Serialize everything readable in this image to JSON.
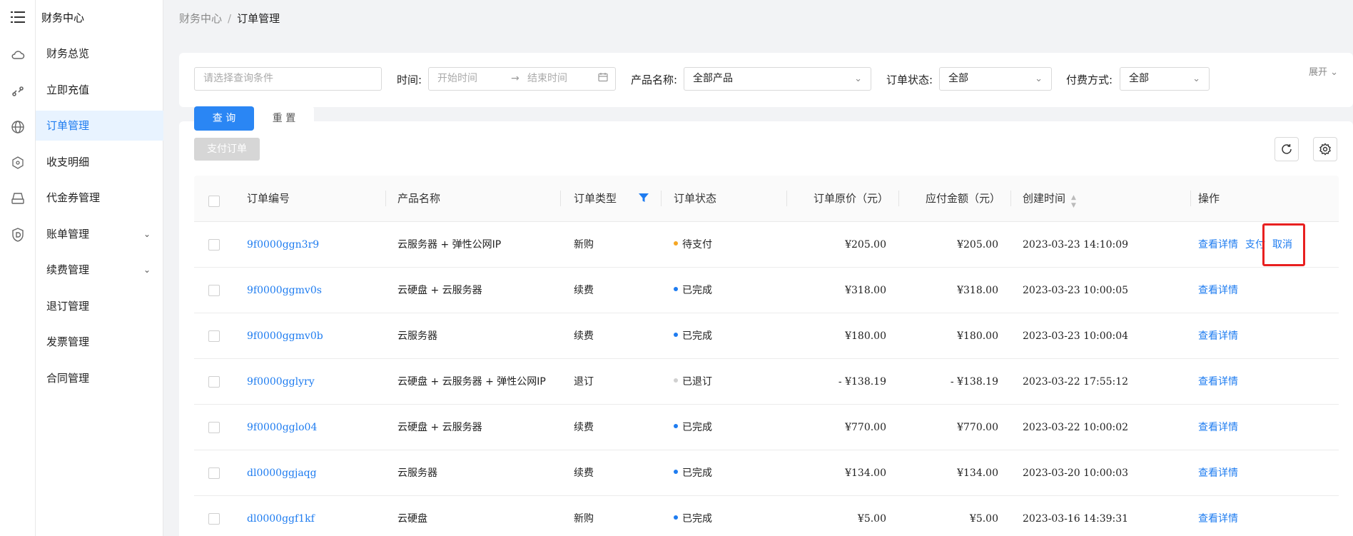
{
  "sidebar": {
    "title": "财务中心",
    "items": [
      {
        "label": "财务总览"
      },
      {
        "label": "立即充值"
      },
      {
        "label": "订单管理",
        "active": true
      },
      {
        "label": "收支明细"
      },
      {
        "label": "代金券管理"
      },
      {
        "label": "账单管理",
        "expandable": true
      },
      {
        "label": "续费管理",
        "expandable": true
      },
      {
        "label": "退订管理"
      },
      {
        "label": "发票管理"
      },
      {
        "label": "合同管理"
      }
    ]
  },
  "breadcrumb": {
    "root": "财务中心",
    "current": "订单管理"
  },
  "filters": {
    "query_placeholder": "请选择查询条件",
    "time_label": "时间:",
    "start_placeholder": "开始时间",
    "end_placeholder": "结束时间",
    "product_label": "产品名称:",
    "product_value": "全部产品",
    "status_label": "订单状态:",
    "status_value": "全部",
    "pay_label": "付费方式:",
    "pay_value": "全部",
    "expand": "展开"
  },
  "buttons": {
    "query": "查 询",
    "reset": "重 置",
    "pay_orders": "支付订单"
  },
  "table": {
    "columns": [
      "订单编号",
      "产品名称",
      "订单类型",
      "订单状态",
      "订单原价（元）",
      "应付金额（元）",
      "创建时间",
      "操作"
    ],
    "rows": [
      {
        "id": "9f0000ggn3r9",
        "product": "云服务器 + 弹性公网IP",
        "type": "新购",
        "status": "待支付",
        "status_color": "#f5a623",
        "orig": "¥205.00",
        "due": "¥205.00",
        "time": "2023-03-23 14:10:09",
        "actions": [
          "查看详情",
          "支付",
          "取消"
        ]
      },
      {
        "id": "9f0000ggmv0s",
        "product": "云硬盘 + 云服务器",
        "type": "续费",
        "status": "已完成",
        "status_color": "#1e7cf0",
        "orig": "¥318.00",
        "due": "¥318.00",
        "time": "2023-03-23 10:00:05",
        "actions": [
          "查看详情"
        ]
      },
      {
        "id": "9f0000ggmv0b",
        "product": "云服务器",
        "type": "续费",
        "status": "已完成",
        "status_color": "#1e7cf0",
        "orig": "¥180.00",
        "due": "¥180.00",
        "time": "2023-03-23 10:00:04",
        "actions": [
          "查看详情"
        ]
      },
      {
        "id": "9f0000gglyry",
        "product": "云硬盘 + 云服务器 + 弹性公网IP",
        "type": "退订",
        "status": "已退订",
        "status_color": "#d0d0d0",
        "orig": "- ¥138.19",
        "due": "- ¥138.19",
        "time": "2023-03-22 17:55:12",
        "actions": [
          "查看详情"
        ]
      },
      {
        "id": "9f0000gglo04",
        "product": "云硬盘 + 云服务器",
        "type": "续费",
        "status": "已完成",
        "status_color": "#1e7cf0",
        "orig": "¥770.00",
        "due": "¥770.00",
        "time": "2023-03-22 10:00:02",
        "actions": [
          "查看详情"
        ]
      },
      {
        "id": "dl0000ggjaqg",
        "product": "云服务器",
        "type": "续费",
        "status": "已完成",
        "status_color": "#1e7cf0",
        "orig": "¥134.00",
        "due": "¥134.00",
        "time": "2023-03-20 10:00:03",
        "actions": [
          "查看详情"
        ]
      },
      {
        "id": "dl0000ggf1kf",
        "product": "云硬盘",
        "type": "新购",
        "status": "已完成",
        "status_color": "#1e7cf0",
        "orig": "¥5.00",
        "due": "¥5.00",
        "time": "2023-03-16 14:39:31",
        "actions": [
          "查看详情"
        ]
      }
    ]
  },
  "colors": {
    "accent": "#1e7cf0",
    "highlight_box": "#e82020"
  },
  "icons": [
    "menu-icon",
    "cloud-icon",
    "link-icon",
    "globe-icon",
    "network-icon",
    "storage-icon",
    "shield-icon",
    "refresh-icon",
    "settings-icon",
    "calendar-icon",
    "filter-icon",
    "sort-icon"
  ]
}
